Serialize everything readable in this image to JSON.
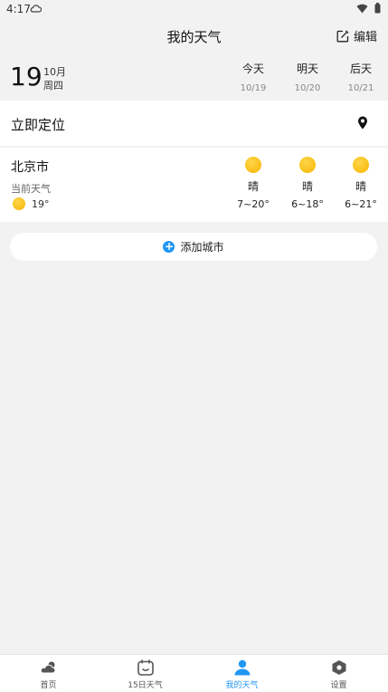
{
  "status_bar": {
    "time": "4:17"
  },
  "header": {
    "title": "我的天气",
    "edit_label": "编辑"
  },
  "date": {
    "day": "19",
    "month": "10月",
    "weekday": "周四"
  },
  "forecast_days": [
    {
      "label": "今天",
      "date": "10/19"
    },
    {
      "label": "明天",
      "date": "10/20"
    },
    {
      "label": "后天",
      "date": "10/21"
    }
  ],
  "locate": {
    "label": "立即定位",
    "icon": "location-pin-icon"
  },
  "city": {
    "name": "北京市",
    "current_label": "当前天气",
    "current_temp": "19°",
    "forecast": [
      {
        "weather": "晴",
        "range": "7~20°",
        "icon": "sun-icon"
      },
      {
        "weather": "晴",
        "range": "6~18°",
        "icon": "sun-icon"
      },
      {
        "weather": "晴",
        "range": "6~21°",
        "icon": "sun-icon"
      }
    ]
  },
  "add_city": {
    "label": "添加城市"
  },
  "tabs": [
    {
      "label": "首页",
      "icon": "weather-cloud-sun-icon"
    },
    {
      "label": "15日天气",
      "icon": "calendar-icon"
    },
    {
      "label": "我的天气",
      "icon": "user-icon",
      "active": true
    },
    {
      "label": "设置",
      "icon": "settings-hexagon-icon"
    }
  ],
  "colors": {
    "accent": "#2196f3",
    "sun": "#f7b500",
    "background": "#f2f2f2"
  }
}
